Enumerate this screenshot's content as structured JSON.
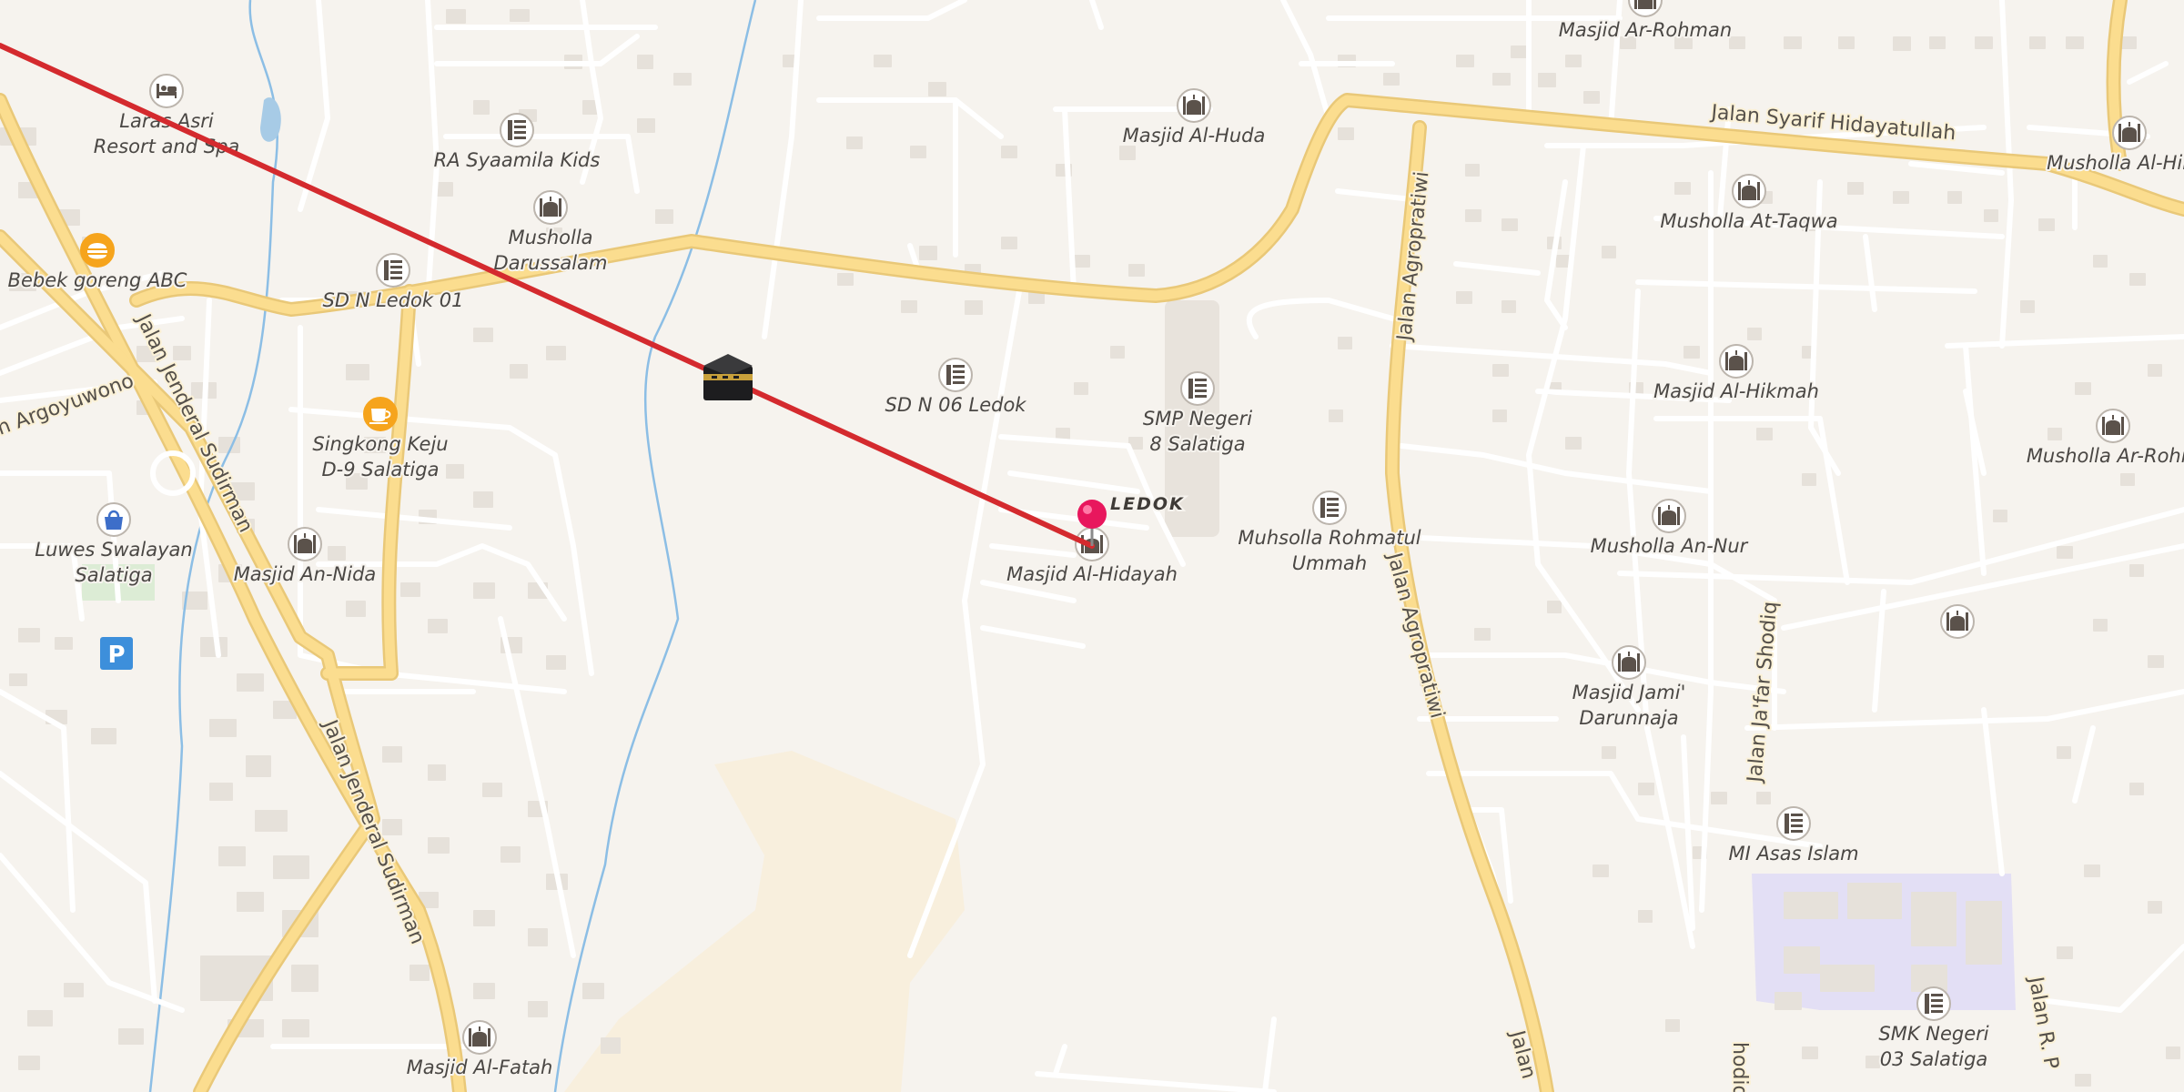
{
  "map": {
    "areas": [
      {
        "key": "ledok",
        "label": "LEDOK"
      }
    ],
    "roads": [
      {
        "key": "syarif",
        "label": "Jalan Syarif Hidayatullah"
      },
      {
        "key": "sudirman1",
        "label": "Jalan Jenderal Sudirman"
      },
      {
        "key": "sudirman2",
        "label": "Jalan Jenderal Sudirman"
      },
      {
        "key": "agro1",
        "label": "Jalan Agropratiwi"
      },
      {
        "key": "agro2",
        "label": "Jalan Agropratiwi"
      },
      {
        "key": "agro3",
        "label": "Jalan"
      },
      {
        "key": "argoyuwono",
        "label": "n Argoyuwono"
      },
      {
        "key": "jafar",
        "label": "Jalan Ja'far Shodiq"
      },
      {
        "key": "shodiq",
        "label": "hodiq"
      },
      {
        "key": "jlr",
        "label": "Jalan R. P"
      }
    ],
    "pois": [
      {
        "key": "laras-asri",
        "icon": "hotel-icon",
        "lines": [
          "Laras Asri",
          "Resort and Spa"
        ]
      },
      {
        "key": "ra-syaamila",
        "icon": "school-icon",
        "lines": [
          "RA Syaamila Kids"
        ]
      },
      {
        "key": "musholla-darussalam",
        "icon": "mosque-icon",
        "lines": [
          "Musholla",
          "Darussalam"
        ]
      },
      {
        "key": "bebek-goreng",
        "icon": "restaurant-icon",
        "lines": [
          "Bebek goreng ABC"
        ]
      },
      {
        "key": "sdn-ledok-01",
        "icon": "school-icon",
        "lines": [
          "SD N Ledok 01"
        ]
      },
      {
        "key": "singkong-keju",
        "icon": "cafe-icon",
        "lines": [
          "Singkong Keju",
          "D-9 Salatiga"
        ]
      },
      {
        "key": "luwes",
        "icon": "shopping-bag-icon",
        "lines": [
          "Luwes Swalayan",
          "Salatiga"
        ]
      },
      {
        "key": "masjid-an-nida",
        "icon": "mosque-icon",
        "lines": [
          "Masjid An-Nida"
        ]
      },
      {
        "key": "sdn-06-ledok",
        "icon": "school-icon",
        "lines": [
          "SD N 06 Ledok"
        ]
      },
      {
        "key": "masjid-al-huda",
        "icon": "mosque-icon",
        "lines": [
          "Masjid Al-Huda"
        ]
      },
      {
        "key": "smp-negeri-8",
        "icon": "school-icon",
        "lines": [
          "SMP Negeri",
          "8 Salatiga"
        ]
      },
      {
        "key": "masjid-al-hidayah",
        "icon": "mosque-icon",
        "lines": [
          "Masjid Al-Hidayah"
        ]
      },
      {
        "key": "muhsolla-rohmatul",
        "icon": "school-icon",
        "lines": [
          "Muhsolla Rohmatul",
          "Ummah"
        ]
      },
      {
        "key": "masjid-ar-rohman",
        "icon": "mosque-icon",
        "lines": [
          "Masjid Ar-Rohman"
        ]
      },
      {
        "key": "musholla-at-taqwa",
        "icon": "mosque-icon",
        "lines": [
          "Musholla At-Taqwa"
        ]
      },
      {
        "key": "masjid-al-hikmah",
        "icon": "mosque-icon",
        "lines": [
          "Masjid Al-Hikmah"
        ]
      },
      {
        "key": "musholla-an-nur",
        "icon": "mosque-icon",
        "lines": [
          "Musholla An-Nur"
        ]
      },
      {
        "key": "masjid-jami",
        "icon": "mosque-icon",
        "lines": [
          "Masjid Jami'",
          "Darunnaja"
        ]
      },
      {
        "key": "mi-asas-islam",
        "icon": "school-icon",
        "lines": [
          "MI Asas Islam"
        ]
      },
      {
        "key": "smk-negeri-03",
        "icon": "school-icon",
        "lines": [
          "SMK Negeri",
          "03 Salatiga"
        ]
      },
      {
        "key": "musholla-al-hikmah",
        "icon": "mosque-icon",
        "lines": [
          "Musholla Al-Hikm"
        ]
      },
      {
        "key": "musholla-ar-rohm",
        "icon": "mosque-icon",
        "lines": [
          "Musholla Ar-Rohm"
        ]
      },
      {
        "key": "mosque-unnamed",
        "icon": "mosque-icon",
        "lines": []
      },
      {
        "key": "masjid-al-fatah",
        "icon": "mosque-icon",
        "lines": [
          "Masjid Al-Fatah"
        ]
      },
      {
        "key": "parking",
        "icon": "parking-icon",
        "lines": []
      }
    ],
    "overlays": {
      "qibla_line": {
        "color": "#d42a2e",
        "marker": "kaaba-icon"
      },
      "location_pin": {
        "color": "#e8175d"
      }
    },
    "colors": {
      "background": "#f6f3ee",
      "major_road_fill": "#fbdd8f",
      "major_road_casing": "#e9c878",
      "minor_road": "#ffffff",
      "water": "#8cbee5",
      "building": "#e6e1da",
      "school_area": "#e3dff5"
    }
  }
}
